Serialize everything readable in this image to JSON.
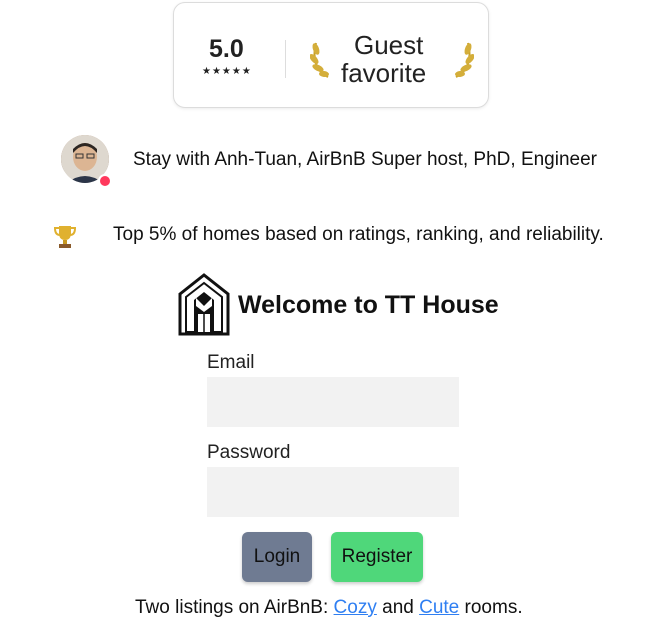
{
  "badge": {
    "rating": "5.0",
    "stars": "★★★★★",
    "title_line1": "Guest",
    "title_line2": "favorite",
    "accent_color": "#c9a227"
  },
  "host": {
    "text": "Stay with Anh-Tuan, AirBnB Super host, PhD, Engineer",
    "avatar_icon": "host-avatar",
    "badge_color": "#ff385c"
  },
  "highlight": {
    "icon": "trophy-icon",
    "text": "Top 5% of homes based on ratings, ranking, and reliability."
  },
  "brand": {
    "logo_icon": "house-logo-icon",
    "welcome": "Welcome to TT House"
  },
  "form": {
    "email_label": "Email",
    "email_value": "",
    "password_label": "Password",
    "password_value": "",
    "login_label": "Login",
    "register_label": "Register",
    "login_color": "#6f7b92",
    "register_color": "#4fd77a"
  },
  "footer": {
    "prefix": "Two listings on AirBnB: ",
    "link1": "Cozy",
    "middle": " and ",
    "link2": "Cute",
    "suffix": " rooms.",
    "link_color": "#2f7ff2"
  }
}
